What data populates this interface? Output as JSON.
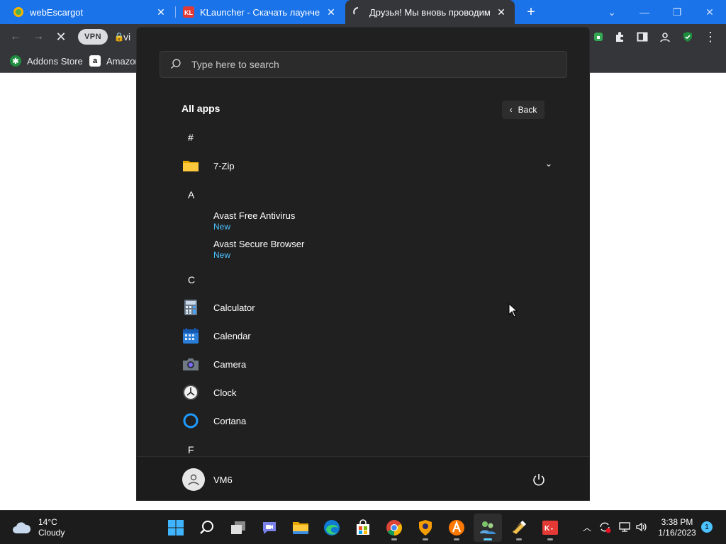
{
  "browser": {
    "tabs": [
      {
        "title": "webEscargot"
      },
      {
        "title": "KLauncher - Скачать лаунчер М"
      },
      {
        "title": "Друзья! Мы вновь проводим ко"
      }
    ],
    "new_tab": "+",
    "vpn_label": "VPN",
    "url_visible": "vi",
    "bookmarks": [
      {
        "label": "Addons Store"
      },
      {
        "label": "Amazon"
      }
    ]
  },
  "start_menu": {
    "search_placeholder": "Type here to search",
    "all_apps_title": "All apps",
    "back_label": "Back",
    "sections": [
      {
        "letter": "#"
      },
      {
        "letter": "A"
      },
      {
        "letter": "C"
      },
      {
        "letter": "F"
      }
    ],
    "apps": [
      {
        "name": "7-Zip",
        "icon": "folder-icon"
      },
      {
        "name": "Avast Free Antivirus",
        "badge": "New"
      },
      {
        "name": "Avast Secure Browser",
        "badge": "New"
      },
      {
        "name": "Calculator",
        "icon": "calculator-icon"
      },
      {
        "name": "Calendar",
        "icon": "calendar-icon"
      },
      {
        "name": "Camera",
        "icon": "camera-icon"
      },
      {
        "name": "Clock",
        "icon": "clock-icon"
      },
      {
        "name": "Cortana",
        "icon": "cortana-icon"
      }
    ],
    "user": {
      "name": "VM6"
    }
  },
  "taskbar": {
    "weather": {
      "temp": "14°C",
      "condition": "Cloudy"
    },
    "clock": {
      "time": "3:38 PM",
      "date": "1/16/2023"
    },
    "notification_count": "1"
  },
  "colors": {
    "tabstrip": "#1a73e8",
    "chrome_dark": "#35363a",
    "start_bg": "#202020",
    "accent": "#4cc2ff"
  }
}
